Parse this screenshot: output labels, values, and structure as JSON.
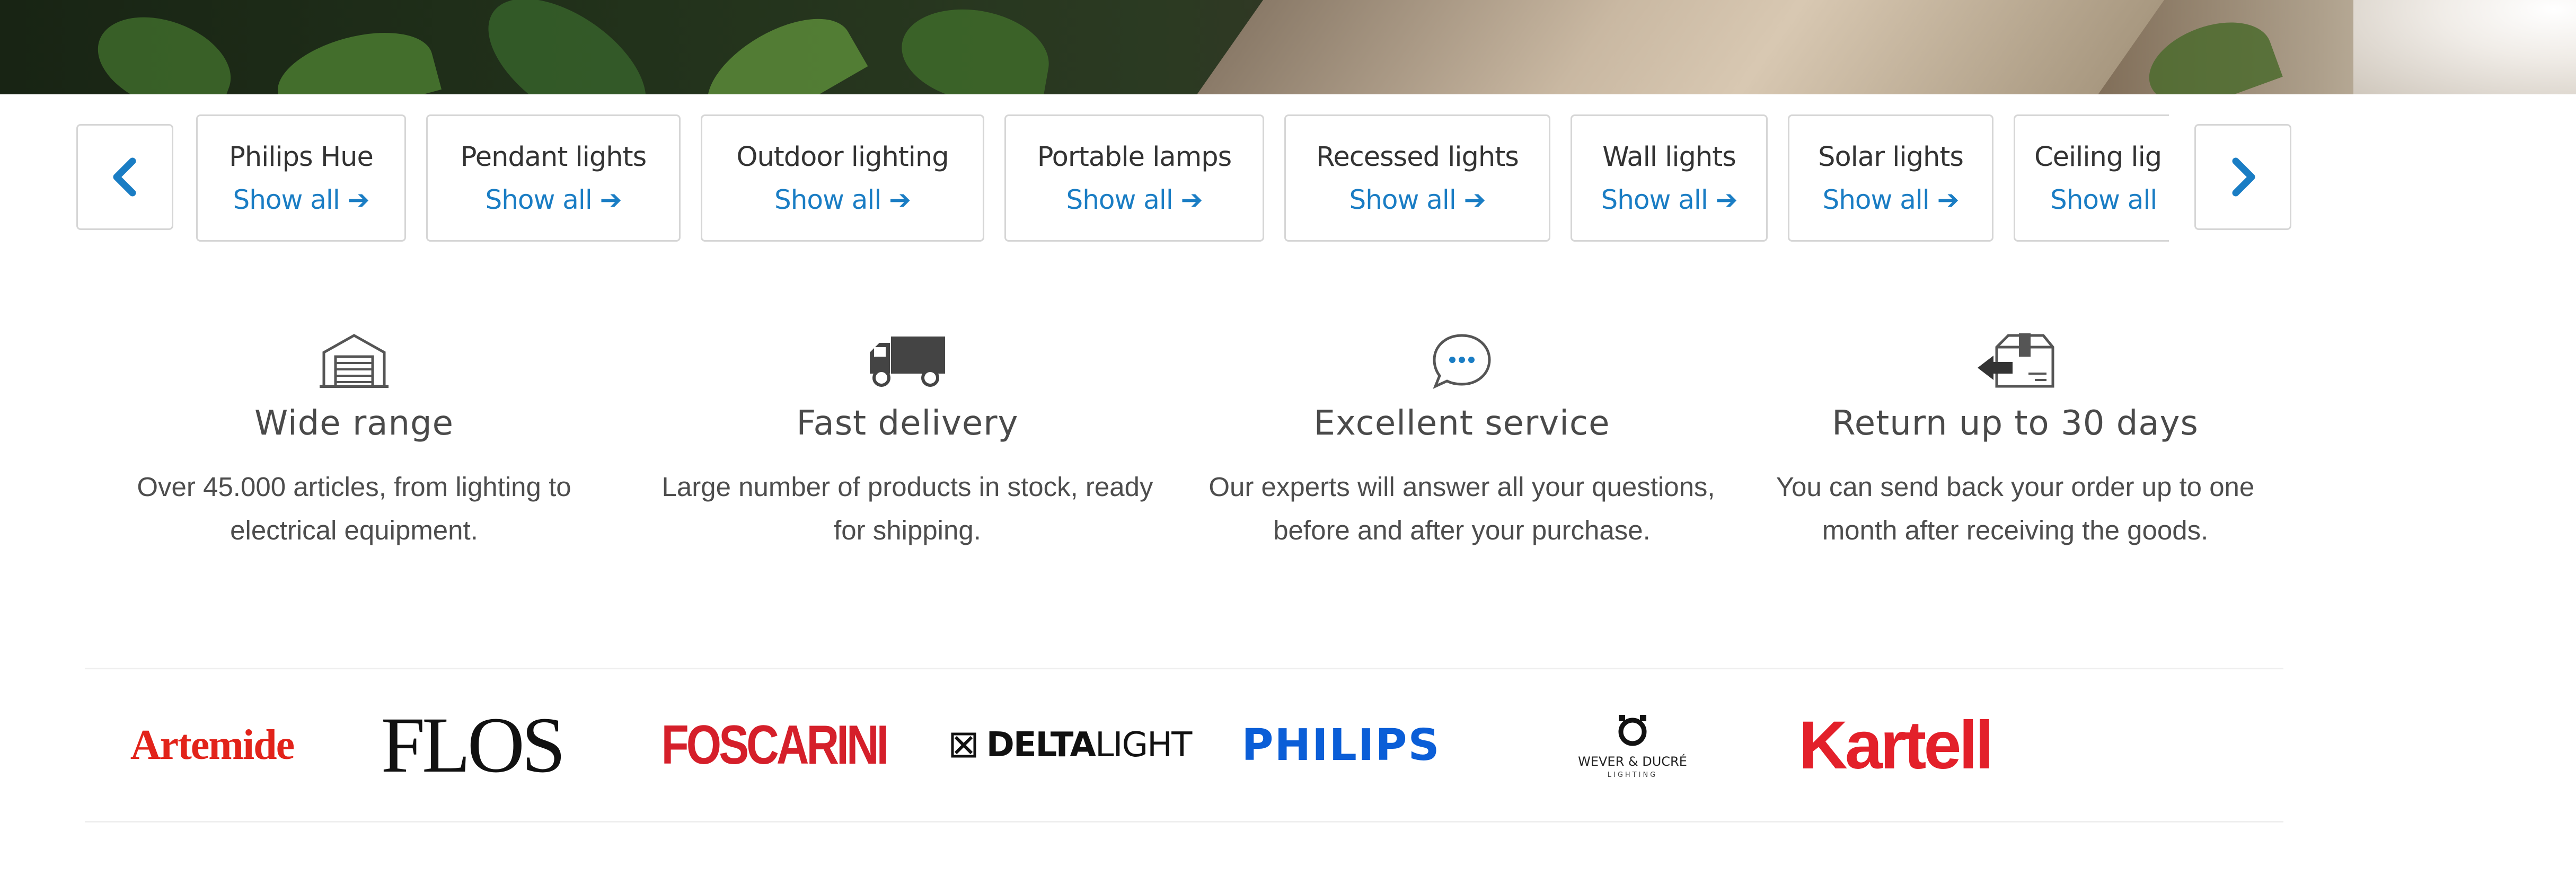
{
  "carousel": {
    "prev_icon": "chevron-left-icon",
    "next_icon": "chevron-right-icon",
    "accent_color": "#1a7dc4",
    "categories": [
      {
        "name": "Philips Hue",
        "link": "Show all ➔"
      },
      {
        "name": "Pendant lights",
        "link": "Show all ➔"
      },
      {
        "name": "Outdoor lighting",
        "link": "Show all ➔"
      },
      {
        "name": "Portable lamps",
        "link": "Show all ➔"
      },
      {
        "name": "Recessed lights",
        "link": "Show all ➔"
      },
      {
        "name": "Wall lights",
        "link": "Show all ➔"
      },
      {
        "name": "Solar lights",
        "link": "Show all ➔"
      },
      {
        "name": "Ceiling lig",
        "link": "Show all"
      }
    ]
  },
  "features": [
    {
      "icon": "warehouse-icon",
      "title": "Wide range",
      "desc": "Over 45.000 articles, from lighting to electrical equipment."
    },
    {
      "icon": "truck-icon",
      "title": "Fast delivery",
      "desc": "Large number of products in stock, ready for shipping."
    },
    {
      "icon": "chat-bubble-icon",
      "title": "Excellent service",
      "desc": "Our experts will answer all your questions, before and after your purchase."
    },
    {
      "icon": "return-box-icon",
      "title": "Return up to 30 days",
      "desc": "You can send back your order up to one month after receiving the goods."
    }
  ],
  "brands": {
    "artemide": "Artemide",
    "flos": "FLOS",
    "foscarini": "FOSCARINI",
    "deltalight_a": "DELTA",
    "deltalight_b": "LIGHT",
    "philips": "PHILIPS",
    "wever": "WEVER & DUCRÉ",
    "wever_sub": "LIGHTING",
    "kartell": "Kartell"
  }
}
